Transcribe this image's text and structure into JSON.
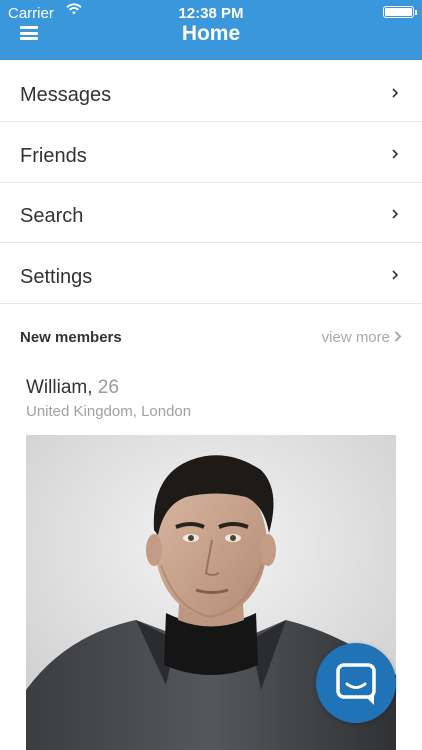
{
  "status_bar": {
    "carrier": "Carrier",
    "time": "12:38 PM"
  },
  "nav": {
    "title": "Home",
    "menu_icon": "hamburger-menu-icon"
  },
  "menu": [
    {
      "label": "Messages"
    },
    {
      "label": "Friends"
    },
    {
      "label": "Search"
    },
    {
      "label": "Settings"
    }
  ],
  "new_members": {
    "heading": "New members",
    "view_more": "view more",
    "member": {
      "name": "William,",
      "age": "26",
      "location": "United Kingdom, London"
    }
  },
  "colors": {
    "brand": "#3a97dc",
    "chat_button": "#1f73b6"
  },
  "icons": {
    "chat": "chat-bubble-icon",
    "chevron": "chevron-right-icon"
  }
}
